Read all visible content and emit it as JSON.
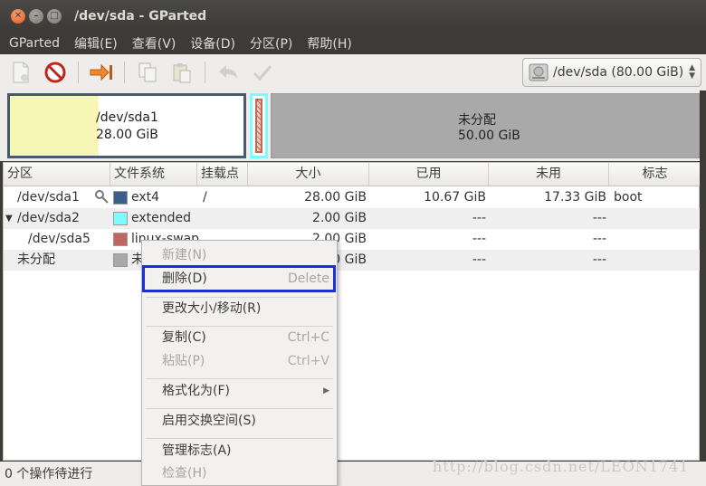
{
  "window": {
    "title": "/dev/sda - GParted"
  },
  "menubar": [
    "GParted",
    "编辑(E)",
    "查看(V)",
    "设备(D)",
    "分区(P)",
    "帮助(H)"
  ],
  "toolbar": {
    "icons": [
      "new-icon",
      "delete-icon",
      "apply-icon",
      "copy-icon",
      "paste-icon",
      "undo-icon",
      "check-icon"
    ],
    "device": "/dev/sda   (80.00 GiB)"
  },
  "disk_map": {
    "sda1": {
      "name": "/dev/sda1",
      "size": "28.00 GiB",
      "used_fraction": 0.38
    },
    "unalloc": {
      "name": "未分配",
      "size": "50.00 GiB"
    }
  },
  "table": {
    "headers": [
      "分区",
      "文件系统",
      "挂载点",
      "大小",
      "已用",
      "未用",
      "标志"
    ],
    "rows": [
      {
        "partition": "/dev/sda1",
        "fs": "ext4",
        "color": "#3b5f86",
        "mount": "/",
        "size": "28.00 GiB",
        "used": "10.67 GiB",
        "unused": "17.33 GiB",
        "flags": "boot"
      },
      {
        "partition": "/dev/sda2",
        "fs": "extended",
        "color": "#7dfcfe",
        "mount": "",
        "size": "2.00 GiB",
        "used": "---",
        "unused": "---",
        "flags": ""
      },
      {
        "partition": "/dev/sda5",
        "fs": "linux-swap",
        "color": "#c1665a",
        "mount": "",
        "size": "2.00 GiB",
        "used": "---",
        "unused": "---",
        "flags": ""
      },
      {
        "partition": "未分配",
        "fs": "未分配",
        "color": "#a9a9a9",
        "mount": "",
        "size": "50.00 GiB",
        "used": "---",
        "unused": "---",
        "flags": ""
      }
    ]
  },
  "context_menu": {
    "new": "新建(N)",
    "delete": "删除(D)",
    "delete_accel": "Delete",
    "resize": "更改大小/移动(R)",
    "copy": "复制(C)",
    "copy_accel": "Ctrl+C",
    "paste": "粘贴(P)",
    "paste_accel": "Ctrl+V",
    "format": "格式化为(F)",
    "swapon": "启用交换空间(S)",
    "flags": "管理标志(A)",
    "check": "检查(H)"
  },
  "status": {
    "text": "0 个操作待进行"
  },
  "watermark": "http://blog.csdn.net/LEON1741"
}
